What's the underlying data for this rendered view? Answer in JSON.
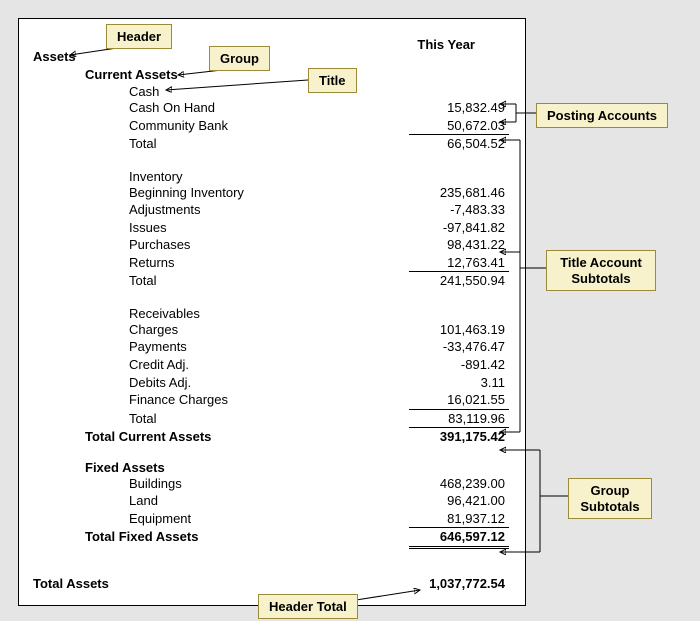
{
  "column_header": "This Year",
  "assets_header": "Assets",
  "current_assets": {
    "title": "Current Assets",
    "cash": {
      "title": "Cash",
      "items": [
        {
          "label": "Cash On Hand",
          "value": "15,832.49"
        },
        {
          "label": "Community Bank",
          "value": "50,672.03"
        }
      ],
      "total_label": "Total",
      "total_value": "66,504.52"
    },
    "inventory": {
      "title": "Inventory",
      "items": [
        {
          "label": "Beginning Inventory",
          "value": "235,681.46"
        },
        {
          "label": "Adjustments",
          "value": "-7,483.33"
        },
        {
          "label": "Issues",
          "value": "-97,841.82"
        },
        {
          "label": "Purchases",
          "value": "98,431.22"
        },
        {
          "label": "Returns",
          "value": "12,763.41"
        }
      ],
      "total_label": "Total",
      "total_value": "241,550.94"
    },
    "receivables": {
      "title": "Receivables",
      "items": [
        {
          "label": "Charges",
          "value": "101,463.19"
        },
        {
          "label": "Payments",
          "value": "-33,476.47"
        },
        {
          "label": "Credit Adj.",
          "value": "-891.42"
        },
        {
          "label": "Debits Adj.",
          "value": "3.11"
        },
        {
          "label": "Finance Charges",
          "value": "16,021.55"
        }
      ],
      "total_label": "Total",
      "total_value": "83,119.96"
    },
    "group_total_label": "Total Current Assets",
    "group_total_value": "391,175.42"
  },
  "fixed_assets": {
    "title": "Fixed Assets",
    "items": [
      {
        "label": "Buildings",
        "value": "468,239.00"
      },
      {
        "label": "Land",
        "value": "96,421.00"
      },
      {
        "label": "Equipment",
        "value": "81,937.12"
      }
    ],
    "group_total_label": "Total Fixed Assets",
    "group_total_value": "646,597.12"
  },
  "header_total_label": "Total Assets",
  "header_total_value": "1,037,772.54",
  "callouts": {
    "header": "Header",
    "group": "Group",
    "title": "Title",
    "posting": "Posting Accounts",
    "title_sub": "Title Account\nSubtotals",
    "group_sub": "Group\nSubtotals",
    "header_total": "Header Total"
  }
}
